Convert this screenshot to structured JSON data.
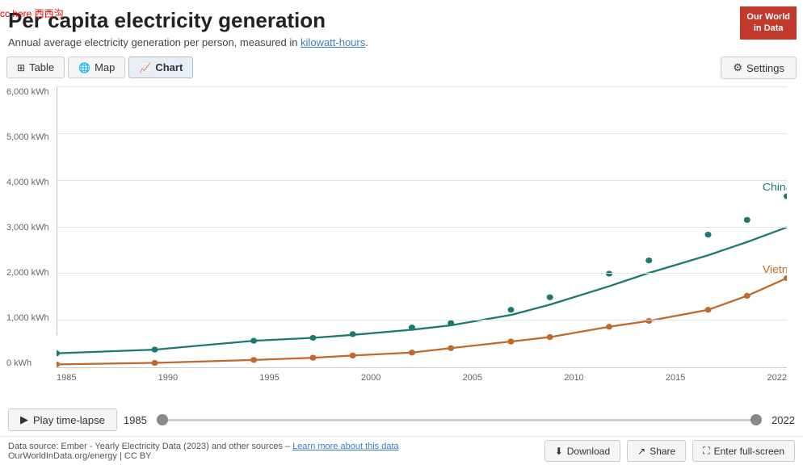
{
  "watermark": {
    "text": "cc here 西西沟"
  },
  "logo": {
    "line1": "Our World",
    "line2": "in Data"
  },
  "title": {
    "main": "Per capita electricity generation",
    "subtitle_pre": "Annual average electricity generation per person, measured in ",
    "subtitle_link": "kilowatt-hours",
    "subtitle_post": "."
  },
  "tabs": [
    {
      "id": "table",
      "label": "Table",
      "icon": "⊞",
      "active": false
    },
    {
      "id": "map",
      "label": "Map",
      "icon": "🌐",
      "active": false
    },
    {
      "id": "chart",
      "label": "Chart",
      "icon": "📈",
      "active": true
    }
  ],
  "settings": {
    "label": "Settings",
    "icon": "⚙"
  },
  "y_axis": {
    "labels": [
      "0 kWh",
      "1,000 kWh",
      "2,000 kWh",
      "3,000 kWh",
      "4,000 kWh",
      "5,000 kWh",
      "6,000 kWh"
    ]
  },
  "x_axis": {
    "labels": [
      "1985",
      "1990",
      "1995",
      "2000",
      "2005",
      "2010",
      "2015",
      "2022"
    ]
  },
  "series": {
    "china": {
      "label": "China",
      "color": "#1a7a6e"
    },
    "vietnam": {
      "label": "Vietnam",
      "color": "#c0692a"
    }
  },
  "timeline": {
    "play_label": "Play time-lapse",
    "year_start": "1985",
    "year_end": "2022"
  },
  "footer": {
    "datasource_pre": "Data source: Ember - Yearly Electricity Data (2023) and other sources – ",
    "datasource_link": "Learn more about this data",
    "copyright": "OurWorldInData.org/energy | CC BY"
  },
  "footer_buttons": [
    {
      "id": "download",
      "icon": "⬇",
      "label": "Download"
    },
    {
      "id": "share",
      "icon": "↗",
      "label": "Share"
    },
    {
      "id": "fullscreen",
      "icon": "⛶",
      "label": "Enter full-screen"
    }
  ],
  "vertical_line_year": "1998"
}
